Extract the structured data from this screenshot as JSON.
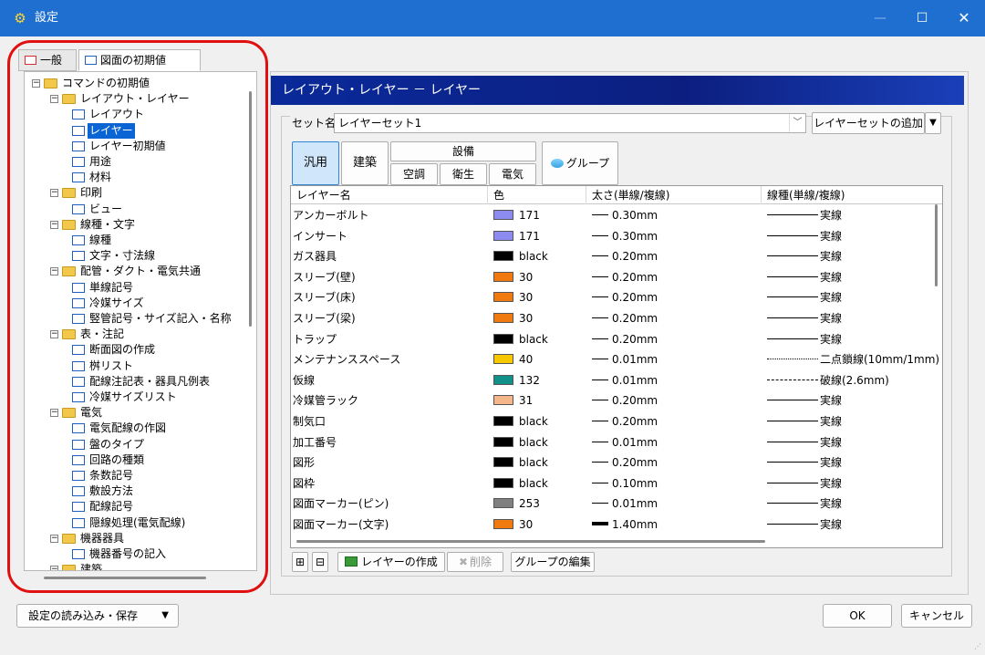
{
  "window": {
    "title": "設定",
    "controls": {
      "minimize": "—",
      "maximize": "☐",
      "close": "✕"
    }
  },
  "left_tabs": [
    {
      "label": "一般",
      "active": false
    },
    {
      "label": "図面の初期値",
      "active": true
    }
  ],
  "tree": [
    {
      "label": "コマンドの初期値",
      "level": 0,
      "kind": "folder",
      "expanded": true
    },
    {
      "label": "レイアウト・レイヤー",
      "level": 1,
      "kind": "folder",
      "expanded": true
    },
    {
      "label": "レイアウト",
      "level": 2,
      "kind": "doc"
    },
    {
      "label": "レイヤー",
      "level": 2,
      "kind": "doc",
      "selected": true
    },
    {
      "label": "レイヤー初期値",
      "level": 2,
      "kind": "doc"
    },
    {
      "label": "用途",
      "level": 2,
      "kind": "doc"
    },
    {
      "label": "材料",
      "level": 2,
      "kind": "doc"
    },
    {
      "label": "印刷",
      "level": 1,
      "kind": "folder",
      "expanded": true
    },
    {
      "label": "ビュー",
      "level": 2,
      "kind": "doc"
    },
    {
      "label": "線種・文字",
      "level": 1,
      "kind": "folder",
      "expanded": true
    },
    {
      "label": "線種",
      "level": 2,
      "kind": "doc"
    },
    {
      "label": "文字・寸法線",
      "level": 2,
      "kind": "doc"
    },
    {
      "label": "配管・ダクト・電気共通",
      "level": 1,
      "kind": "folder",
      "expanded": true
    },
    {
      "label": "単線記号",
      "level": 2,
      "kind": "doc"
    },
    {
      "label": "冷媒サイズ",
      "level": 2,
      "kind": "doc"
    },
    {
      "label": "竪管記号・サイズ記入・名称",
      "level": 2,
      "kind": "doc"
    },
    {
      "label": "表・注記",
      "level": 1,
      "kind": "folder",
      "expanded": true
    },
    {
      "label": "断面図の作成",
      "level": 2,
      "kind": "doc"
    },
    {
      "label": "桝リスト",
      "level": 2,
      "kind": "doc"
    },
    {
      "label": "配線注記表・器具凡例表",
      "level": 2,
      "kind": "doc"
    },
    {
      "label": "冷媒サイズリスト",
      "level": 2,
      "kind": "doc"
    },
    {
      "label": "電気",
      "level": 1,
      "kind": "folder",
      "expanded": true
    },
    {
      "label": "電気配線の作図",
      "level": 2,
      "kind": "doc"
    },
    {
      "label": "盤のタイプ",
      "level": 2,
      "kind": "doc"
    },
    {
      "label": "回路の種類",
      "level": 2,
      "kind": "doc"
    },
    {
      "label": "条数記号",
      "level": 2,
      "kind": "doc"
    },
    {
      "label": "敷設方法",
      "level": 2,
      "kind": "doc"
    },
    {
      "label": "配線記号",
      "level": 2,
      "kind": "doc"
    },
    {
      "label": "隠線処理(電気配線)",
      "level": 2,
      "kind": "doc"
    },
    {
      "label": "機器器具",
      "level": 1,
      "kind": "folder",
      "expanded": true
    },
    {
      "label": "機器番号の記入",
      "level": 2,
      "kind": "doc"
    },
    {
      "label": "建築",
      "level": 1,
      "kind": "folder",
      "expanded": true
    }
  ],
  "section": {
    "title": "レイアウト・レイヤー － レイヤー"
  },
  "set": {
    "label": "セット名",
    "value": "レイヤーセット1",
    "add_button": "レイヤーセットの追加"
  },
  "filters": {
    "general": "汎用",
    "architecture": "建築",
    "facility": "設備",
    "hvac": "空調",
    "sanitary": "衛生",
    "electric": "電気",
    "group": "グループ"
  },
  "table": {
    "headers": [
      "レイヤー名",
      "色",
      "太さ(単線/複線)",
      "線種(単線/複線)"
    ],
    "rows": [
      {
        "name": "アンカーボルト",
        "color": "171",
        "swatch": "#8c8cf0",
        "width": "0.30mm",
        "thick": false,
        "ltype": "実線",
        "style": "solid"
      },
      {
        "name": "インサート",
        "color": "171",
        "swatch": "#8c8cf0",
        "width": "0.30mm",
        "thick": false,
        "ltype": "実線",
        "style": "solid"
      },
      {
        "name": "ガス器具",
        "color": "black",
        "swatch": "#000000",
        "width": "0.20mm",
        "thick": false,
        "ltype": "実線",
        "style": "solid"
      },
      {
        "name": "スリーブ(壁)",
        "color": "30",
        "swatch": "#f07a10",
        "width": "0.20mm",
        "thick": false,
        "ltype": "実線",
        "style": "solid"
      },
      {
        "name": "スリーブ(床)",
        "color": "30",
        "swatch": "#f07a10",
        "width": "0.20mm",
        "thick": false,
        "ltype": "実線",
        "style": "solid"
      },
      {
        "name": "スリーブ(梁)",
        "color": "30",
        "swatch": "#f07a10",
        "width": "0.20mm",
        "thick": false,
        "ltype": "実線",
        "style": "solid"
      },
      {
        "name": "トラップ",
        "color": "black",
        "swatch": "#000000",
        "width": "0.20mm",
        "thick": false,
        "ltype": "実線",
        "style": "solid"
      },
      {
        "name": "メンテナンススペース",
        "color": "40",
        "swatch": "#f7c800",
        "width": "0.01mm",
        "thick": false,
        "ltype": "二点鎖線(10mm/1mm)",
        "style": "dashdot"
      },
      {
        "name": "仮線",
        "color": "132",
        "swatch": "#12908a",
        "width": "0.01mm",
        "thick": false,
        "ltype": "破線(2.6mm)",
        "style": "dash"
      },
      {
        "name": "冷媒管ラック",
        "color": "31",
        "swatch": "#f5b78a",
        "width": "0.20mm",
        "thick": false,
        "ltype": "実線",
        "style": "solid"
      },
      {
        "name": "制気口",
        "color": "black",
        "swatch": "#000000",
        "width": "0.20mm",
        "thick": false,
        "ltype": "実線",
        "style": "solid"
      },
      {
        "name": "加工番号",
        "color": "black",
        "swatch": "#000000",
        "width": "0.01mm",
        "thick": false,
        "ltype": "実線",
        "style": "solid"
      },
      {
        "name": "図形",
        "color": "black",
        "swatch": "#000000",
        "width": "0.20mm",
        "thick": false,
        "ltype": "実線",
        "style": "solid"
      },
      {
        "name": "図枠",
        "color": "black",
        "swatch": "#000000",
        "width": "0.10mm",
        "thick": false,
        "ltype": "実線",
        "style": "solid"
      },
      {
        "name": "図面マーカー(ピン)",
        "color": "253",
        "swatch": "#808080",
        "width": "0.01mm",
        "thick": false,
        "ltype": "実線",
        "style": "solid"
      },
      {
        "name": "図面マーカー(文字)",
        "color": "30",
        "swatch": "#f07a10",
        "width": "1.40mm",
        "thick": true,
        "ltype": "実線",
        "style": "solid"
      }
    ]
  },
  "toolbar": {
    "expand": "⊞",
    "collapse": "⊟",
    "create": "レイヤーの作成",
    "delete": "削除",
    "edit_group": "グループの編集"
  },
  "bottom": {
    "load_save": "設定の読み込み・保存",
    "ok": "OK",
    "cancel": "キャンセル"
  }
}
